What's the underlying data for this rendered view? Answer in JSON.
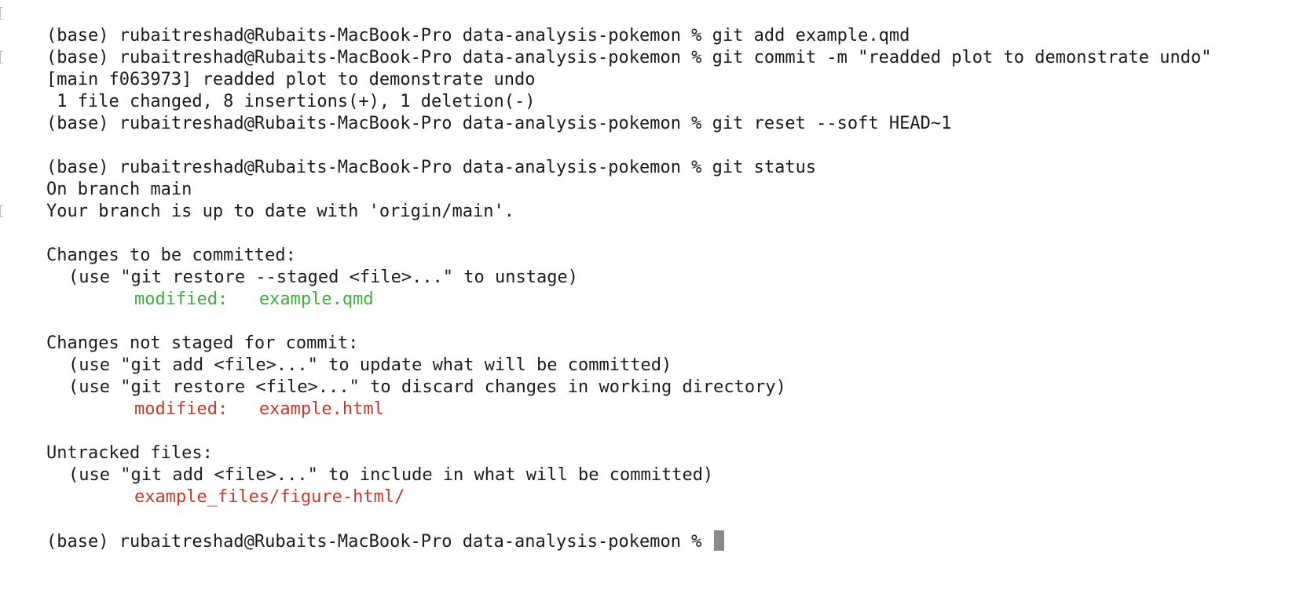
{
  "terminal": {
    "lines": {
      "l1": "(base) rubaitreshad@Rubaits-MacBook-Pro data-analysis-pokemon % git add example.qmd",
      "l2": "(base) rubaitreshad@Rubaits-MacBook-Pro data-analysis-pokemon % git commit -m \"readded plot to demonstrate undo\"",
      "l3": "[main f063973] readded plot to demonstrate undo",
      "l4": " 1 file changed, 8 insertions(+), 1 deletion(-)",
      "l5": "(base) rubaitreshad@Rubaits-MacBook-Pro data-analysis-pokemon % git reset --soft HEAD~1",
      "l7": "(base) rubaitreshad@Rubaits-MacBook-Pro data-analysis-pokemon % git status",
      "l8": "On branch main",
      "l9": "Your branch is up to date with 'origin/main'.",
      "l11": "Changes to be committed:",
      "l12": "(use \"git restore --staged <file>...\" to unstage)",
      "l13": "modified:   example.qmd",
      "l15": "Changes not staged for commit:",
      "l16": "(use \"git add <file>...\" to update what will be committed)",
      "l17": "(use \"git restore <file>...\" to discard changes in working directory)",
      "l18": "modified:   example.html",
      "l20": "Untracked files:",
      "l21": "(use \"git add <file>...\" to include in what will be committed)",
      "l22": "example_files/figure-html/",
      "l24": "(base) rubaitreshad@Rubaits-MacBook-Pro data-analysis-pokemon % "
    },
    "colors": {
      "text": "#1b1b1b",
      "staged": "#3fae3f",
      "unstaged": "#c0392b",
      "cursor": "#8a8a8a",
      "background": "#ffffff"
    }
  }
}
